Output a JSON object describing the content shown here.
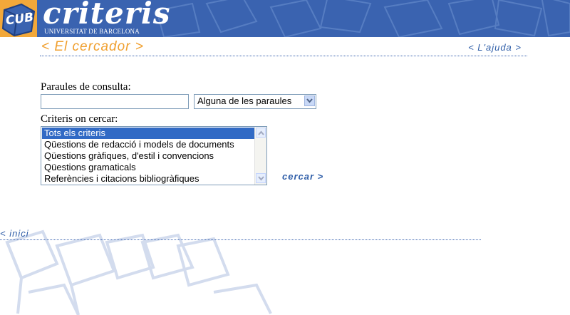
{
  "header": {
    "logo_text": "CUB",
    "brand": "criteris",
    "subtitle": "UNIVERSITAT DE BARCELONA"
  },
  "subheader": {
    "section_title": "< El cercador >",
    "help_link": "< L'ajuda >"
  },
  "form": {
    "query_label": "Paraules de consulta:",
    "query_value": "",
    "mode_select": {
      "selected": "Alguna de les paraules"
    },
    "criteria_label": "Criteris on cercar:",
    "criteria_options": [
      "Tots els criteris",
      "Qüestions de redacció i models de documents",
      "Qüestions gràfiques, d'estil i convencions",
      "Qüestions gramaticals",
      "Referències i citacions bibliogràfiques"
    ],
    "criteria_selected_index": 0,
    "search_link": "cercar >"
  },
  "footer": {
    "home_link": "< inici"
  },
  "colors": {
    "header_blue": "#3a63b0",
    "logo_orange": "#f2a83a",
    "title_orange": "#f0a030",
    "link_blue": "#2f5ea8",
    "selection_blue": "#316ac5"
  }
}
